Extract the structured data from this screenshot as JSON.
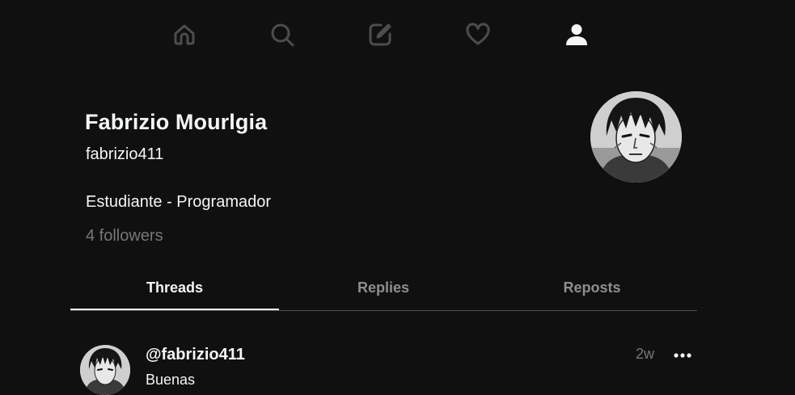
{
  "nav": {
    "items": [
      {
        "icon": "home-icon",
        "active": false
      },
      {
        "icon": "search-icon",
        "active": false
      },
      {
        "icon": "compose-icon",
        "active": false
      },
      {
        "icon": "heart-icon",
        "active": false
      },
      {
        "icon": "user-icon",
        "active": true
      }
    ]
  },
  "profile": {
    "name": "Fabrizio Mourlgia",
    "username": "fabrizio411",
    "bio": "Estudiante - Programador",
    "followers": "4 followers"
  },
  "tabs": [
    {
      "label": "Threads",
      "active": true
    },
    {
      "label": "Replies",
      "active": false
    },
    {
      "label": "Reposts",
      "active": false
    }
  ],
  "posts": [
    {
      "user": "@fabrizio411",
      "text": "Buenas",
      "time": "2w"
    }
  ],
  "colors": {
    "background": "#101010",
    "text": "#f3f5f7",
    "muted": "#777777",
    "nav_inactive": "#4d4d4d",
    "divider": "#4d4d4d"
  }
}
